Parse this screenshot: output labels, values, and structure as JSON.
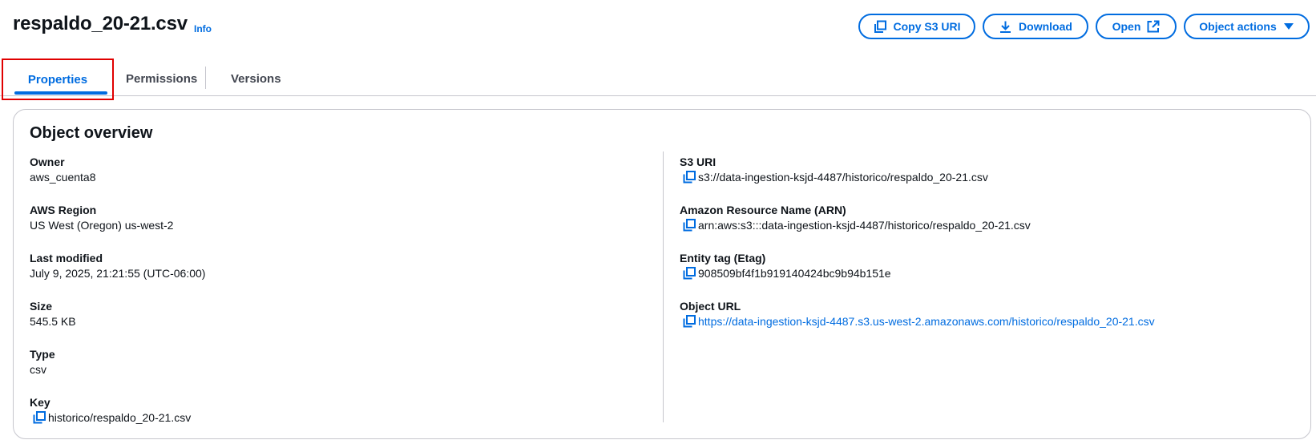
{
  "header": {
    "title": "respaldo_20-21.csv",
    "info": "Info",
    "buttons": {
      "copy_s3_uri": "Copy S3 URI",
      "download": "Download",
      "open": "Open",
      "object_actions": "Object actions"
    }
  },
  "tabs": [
    {
      "label": "Properties",
      "active": true
    },
    {
      "label": "Permissions",
      "active": false
    },
    {
      "label": "Versions",
      "active": false
    }
  ],
  "overview": {
    "title": "Object overview",
    "left": [
      {
        "label": "Owner",
        "value": "aws_cuenta8"
      },
      {
        "label": "AWS Region",
        "value": "US West (Oregon) us-west-2"
      },
      {
        "label": "Last modified",
        "value": "July 9, 2025, 21:21:55 (UTC-06:00)"
      },
      {
        "label": "Size",
        "value": "545.5 KB"
      },
      {
        "label": "Type",
        "value": "csv"
      },
      {
        "label": "Key",
        "value": "historico/respaldo_20-21.csv"
      }
    ],
    "right": [
      {
        "label": "S3 URI",
        "value": "s3://data-ingestion-ksjd-4487/historico/respaldo_20-21.csv"
      },
      {
        "label": "Amazon Resource Name (ARN)",
        "value": "arn:aws:s3:::data-ingestion-ksjd-4487/historico/respaldo_20-21.csv"
      },
      {
        "label": "Entity tag (Etag)",
        "value": "908509bf4f1b919140424bc9b94b151e"
      },
      {
        "label": "Object URL",
        "value": "https://data-ingestion-ksjd-4487.s3.us-west-2.amazonaws.com/historico/respaldo_20-21.csv"
      }
    ]
  },
  "colors": {
    "accent": "#006ce0",
    "highlight_box": "#e00000",
    "border": "#c6c6cd",
    "text": "#0f141a"
  },
  "icons": [
    "copy-icon",
    "download-icon",
    "external-link-icon",
    "caret-down-icon"
  ]
}
